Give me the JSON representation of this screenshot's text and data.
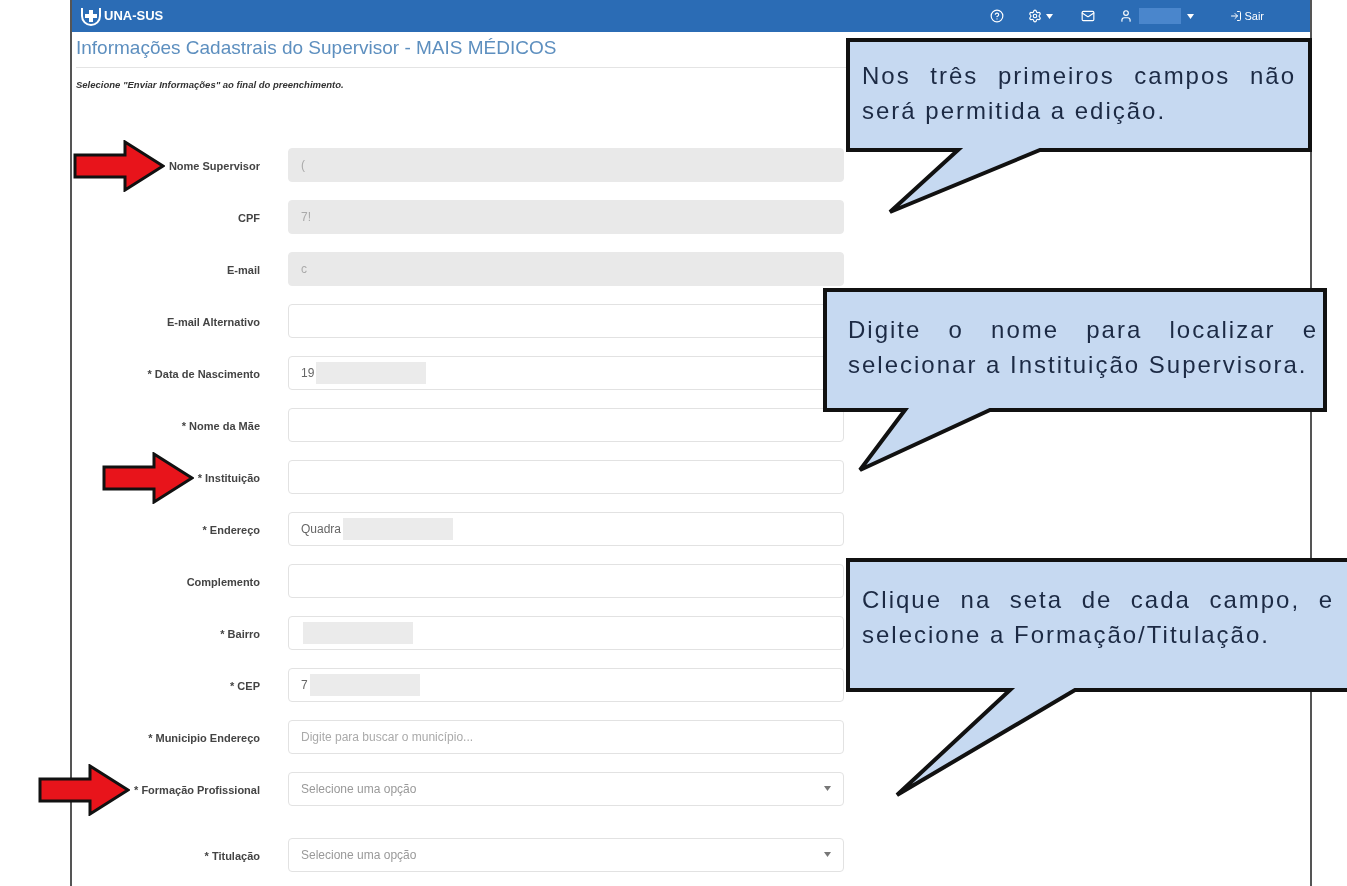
{
  "header": {
    "logo_text": "UNA-SUS",
    "user_name_redacted": true,
    "logout_label": "Sair"
  },
  "page_title": "Informações Cadastrais do Supervisor - MAIS MÉDICOS",
  "instruction": "Selecione \"Enviar Informações\" ao final do preenchimento.",
  "fields": [
    {
      "label": "Nome Supervisor",
      "kind": "text",
      "disabled": true,
      "value": "(",
      "redacted": false,
      "pointed": true
    },
    {
      "label": "CPF",
      "kind": "text",
      "disabled": true,
      "value": "7!",
      "redacted": false,
      "pointed": false
    },
    {
      "label": "E-mail",
      "kind": "text",
      "disabled": true,
      "value": "c",
      "redacted": false,
      "pointed": false
    },
    {
      "label": "E-mail Alternativo",
      "kind": "text",
      "disabled": false,
      "redacted": false,
      "pointed": false
    },
    {
      "label": "* Data de Nascimento",
      "kind": "text",
      "disabled": false,
      "value": "19",
      "redacted": true,
      "pointed": false
    },
    {
      "label": "* Nome da Mãe",
      "kind": "text",
      "disabled": false,
      "redacted": false,
      "pointed": false
    },
    {
      "label": "* Instituição",
      "kind": "text",
      "disabled": false,
      "redacted": false,
      "pointed": true
    },
    {
      "label": "* Endereço",
      "kind": "text",
      "disabled": false,
      "value": "Quadra",
      "redacted": true,
      "pointed": false
    },
    {
      "label": "Complemento",
      "kind": "text",
      "disabled": false,
      "redacted": false,
      "pointed": false
    },
    {
      "label": "* Bairro",
      "kind": "text",
      "disabled": false,
      "redacted": true,
      "pointed": false
    },
    {
      "label": "* CEP",
      "kind": "text",
      "disabled": false,
      "value": "7",
      "redacted": true,
      "pointed": false
    },
    {
      "label": "* Municipio Endereço",
      "kind": "search",
      "disabled": false,
      "placeholder": "Digite para buscar o município...",
      "redacted": false,
      "pointed": false
    },
    {
      "label": "* Formação Profissional",
      "kind": "select",
      "disabled": false,
      "placeholder": "Selecione uma opção",
      "redacted": false,
      "pointed": true
    },
    {
      "label": "* Titulação",
      "kind": "select",
      "disabled": false,
      "placeholder": "Selecione uma opção",
      "redacted": false,
      "pointed": false
    }
  ],
  "callouts": [
    {
      "text": "Nos três primeiros campos não será permitida a edição."
    },
    {
      "text": "Digite o nome para localizar e selecionar a Instituição Supervisora."
    },
    {
      "text": "Clique na seta de cada campo, e selecione a Formação/Titulação."
    }
  ]
}
